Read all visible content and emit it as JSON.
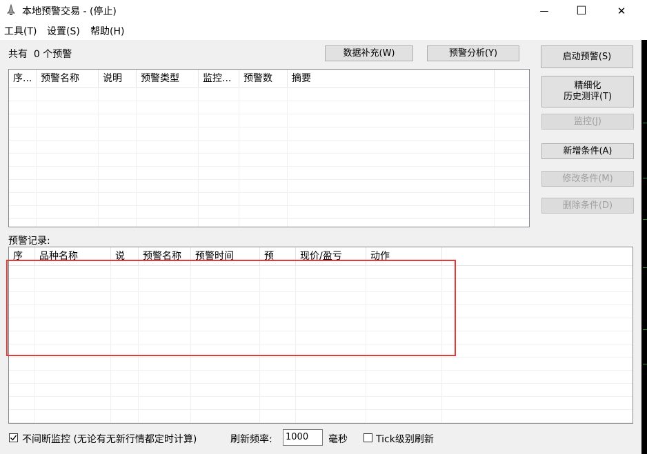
{
  "window": {
    "title": "本地预警交易  - (停止)",
    "minimize_glyph": "—",
    "maximize_glyph": "☐",
    "close_glyph": "✕"
  },
  "menu": [
    "工具(T)",
    "设置(S)",
    "帮助(H)"
  ],
  "summary": {
    "count_label": "共有  0 个预警"
  },
  "buttons": {
    "data_fill": "数据补充(W)",
    "alert_analysis": "预警分析(Y)",
    "start_alert": "启动预警(S)",
    "backtest": "精细化\n历史测评(T)",
    "monitor": "监控(J)",
    "add_condition": "新增条件(A)",
    "edit_condition": "修改条件(M)",
    "delete_condition": "删除条件(D)"
  },
  "alerts_table": {
    "columns": [
      "序...",
      "预警名称",
      "说明",
      "预警类型",
      "监控...",
      "预警数",
      "摘要",
      ""
    ],
    "rows": []
  },
  "records_label": "预警记录:",
  "records_table": {
    "columns": [
      "序",
      "品种名称",
      "说",
      "预警名称",
      "预警时间",
      "预",
      "现价/盈亏",
      "动作"
    ],
    "rows": []
  },
  "bottom": {
    "continuous_label": "不间断监控 (无论有无新行情都定时计算)",
    "continuous_checked": true,
    "refresh_label": "刷新频率:",
    "refresh_value": "1000",
    "unit_label": "毫秒",
    "tick_label": "Tick级别刷新",
    "tick_checked": false
  },
  "colors": {
    "highlight": "#e53935",
    "window_bg": "#f0f0f0"
  }
}
